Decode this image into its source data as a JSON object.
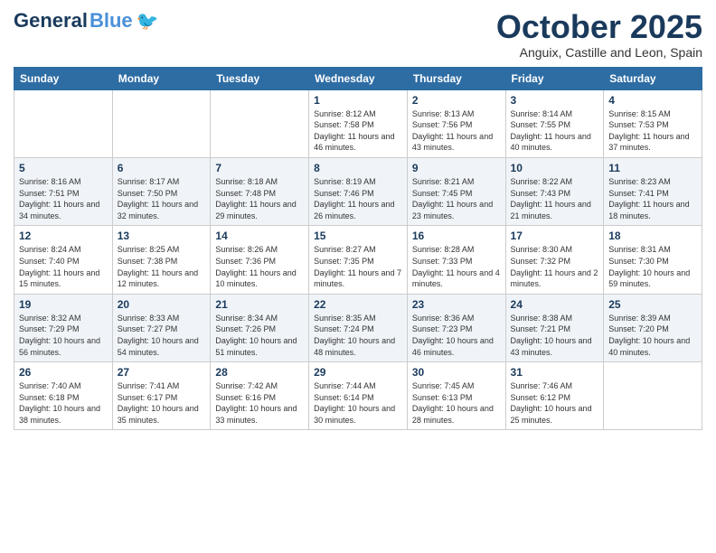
{
  "header": {
    "logo_general": "General",
    "logo_blue": "Blue",
    "month_title": "October 2025",
    "subtitle": "Anguix, Castille and Leon, Spain"
  },
  "days_of_week": [
    "Sunday",
    "Monday",
    "Tuesday",
    "Wednesday",
    "Thursday",
    "Friday",
    "Saturday"
  ],
  "weeks": [
    [
      {
        "day": "",
        "info": ""
      },
      {
        "day": "",
        "info": ""
      },
      {
        "day": "",
        "info": ""
      },
      {
        "day": "1",
        "info": "Sunrise: 8:12 AM\nSunset: 7:58 PM\nDaylight: 11 hours and 46 minutes."
      },
      {
        "day": "2",
        "info": "Sunrise: 8:13 AM\nSunset: 7:56 PM\nDaylight: 11 hours and 43 minutes."
      },
      {
        "day": "3",
        "info": "Sunrise: 8:14 AM\nSunset: 7:55 PM\nDaylight: 11 hours and 40 minutes."
      },
      {
        "day": "4",
        "info": "Sunrise: 8:15 AM\nSunset: 7:53 PM\nDaylight: 11 hours and 37 minutes."
      }
    ],
    [
      {
        "day": "5",
        "info": "Sunrise: 8:16 AM\nSunset: 7:51 PM\nDaylight: 11 hours and 34 minutes."
      },
      {
        "day": "6",
        "info": "Sunrise: 8:17 AM\nSunset: 7:50 PM\nDaylight: 11 hours and 32 minutes."
      },
      {
        "day": "7",
        "info": "Sunrise: 8:18 AM\nSunset: 7:48 PM\nDaylight: 11 hours and 29 minutes."
      },
      {
        "day": "8",
        "info": "Sunrise: 8:19 AM\nSunset: 7:46 PM\nDaylight: 11 hours and 26 minutes."
      },
      {
        "day": "9",
        "info": "Sunrise: 8:21 AM\nSunset: 7:45 PM\nDaylight: 11 hours and 23 minutes."
      },
      {
        "day": "10",
        "info": "Sunrise: 8:22 AM\nSunset: 7:43 PM\nDaylight: 11 hours and 21 minutes."
      },
      {
        "day": "11",
        "info": "Sunrise: 8:23 AM\nSunset: 7:41 PM\nDaylight: 11 hours and 18 minutes."
      }
    ],
    [
      {
        "day": "12",
        "info": "Sunrise: 8:24 AM\nSunset: 7:40 PM\nDaylight: 11 hours and 15 minutes."
      },
      {
        "day": "13",
        "info": "Sunrise: 8:25 AM\nSunset: 7:38 PM\nDaylight: 11 hours and 12 minutes."
      },
      {
        "day": "14",
        "info": "Sunrise: 8:26 AM\nSunset: 7:36 PM\nDaylight: 11 hours and 10 minutes."
      },
      {
        "day": "15",
        "info": "Sunrise: 8:27 AM\nSunset: 7:35 PM\nDaylight: 11 hours and 7 minutes."
      },
      {
        "day": "16",
        "info": "Sunrise: 8:28 AM\nSunset: 7:33 PM\nDaylight: 11 hours and 4 minutes."
      },
      {
        "day": "17",
        "info": "Sunrise: 8:30 AM\nSunset: 7:32 PM\nDaylight: 11 hours and 2 minutes."
      },
      {
        "day": "18",
        "info": "Sunrise: 8:31 AM\nSunset: 7:30 PM\nDaylight: 10 hours and 59 minutes."
      }
    ],
    [
      {
        "day": "19",
        "info": "Sunrise: 8:32 AM\nSunset: 7:29 PM\nDaylight: 10 hours and 56 minutes."
      },
      {
        "day": "20",
        "info": "Sunrise: 8:33 AM\nSunset: 7:27 PM\nDaylight: 10 hours and 54 minutes."
      },
      {
        "day": "21",
        "info": "Sunrise: 8:34 AM\nSunset: 7:26 PM\nDaylight: 10 hours and 51 minutes."
      },
      {
        "day": "22",
        "info": "Sunrise: 8:35 AM\nSunset: 7:24 PM\nDaylight: 10 hours and 48 minutes."
      },
      {
        "day": "23",
        "info": "Sunrise: 8:36 AM\nSunset: 7:23 PM\nDaylight: 10 hours and 46 minutes."
      },
      {
        "day": "24",
        "info": "Sunrise: 8:38 AM\nSunset: 7:21 PM\nDaylight: 10 hours and 43 minutes."
      },
      {
        "day": "25",
        "info": "Sunrise: 8:39 AM\nSunset: 7:20 PM\nDaylight: 10 hours and 40 minutes."
      }
    ],
    [
      {
        "day": "26",
        "info": "Sunrise: 7:40 AM\nSunset: 6:18 PM\nDaylight: 10 hours and 38 minutes."
      },
      {
        "day": "27",
        "info": "Sunrise: 7:41 AM\nSunset: 6:17 PM\nDaylight: 10 hours and 35 minutes."
      },
      {
        "day": "28",
        "info": "Sunrise: 7:42 AM\nSunset: 6:16 PM\nDaylight: 10 hours and 33 minutes."
      },
      {
        "day": "29",
        "info": "Sunrise: 7:44 AM\nSunset: 6:14 PM\nDaylight: 10 hours and 30 minutes."
      },
      {
        "day": "30",
        "info": "Sunrise: 7:45 AM\nSunset: 6:13 PM\nDaylight: 10 hours and 28 minutes."
      },
      {
        "day": "31",
        "info": "Sunrise: 7:46 AM\nSunset: 6:12 PM\nDaylight: 10 hours and 25 minutes."
      },
      {
        "day": "",
        "info": ""
      }
    ]
  ]
}
